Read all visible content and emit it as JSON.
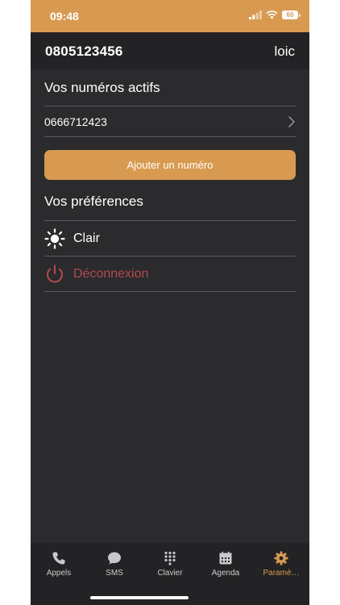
{
  "status_bar": {
    "time": "09:48",
    "battery": "60"
  },
  "header": {
    "phone_number": "0805123456",
    "user_name": "loic"
  },
  "active_numbers": {
    "title": "Vos numéros actifs",
    "items": [
      {
        "number": "0666712423"
      }
    ],
    "add_button_label": "Ajouter un numéro"
  },
  "preferences": {
    "title": "Vos préférences",
    "theme_label": "Clair",
    "logout_label": "Déconnexion"
  },
  "tabs": [
    {
      "label": "Appels",
      "icon": "phone-icon",
      "active": false
    },
    {
      "label": "SMS",
      "icon": "chat-bubble-icon",
      "active": false
    },
    {
      "label": "Clavier",
      "icon": "keypad-icon",
      "active": false
    },
    {
      "label": "Agenda",
      "icon": "calendar-icon",
      "active": false
    },
    {
      "label": "Paramè…",
      "icon": "gear-icon",
      "active": true
    }
  ],
  "colors": {
    "accent": "#d89a50",
    "background": "#2b2b2d",
    "header_background": "#232325",
    "logout_text": "#b5484f"
  }
}
